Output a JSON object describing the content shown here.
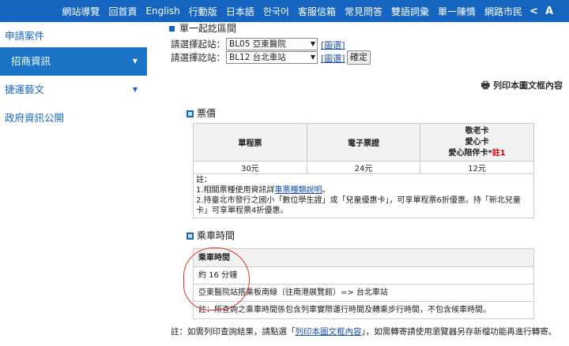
{
  "topnav": {
    "links": [
      "網站導覽",
      "回首頁",
      "English",
      "行動版",
      "日本語",
      "한국어",
      "客服信箱",
      "常見問答",
      "雙語詞彙",
      "單一陳情",
      "網路市民"
    ],
    "share_icon": "share-icon",
    "font_icon": "font-size-icon"
  },
  "sidebar": {
    "items": [
      {
        "label": "申請案件"
      },
      {
        "label": "招商資訊"
      },
      {
        "label": "捷運藝文"
      },
      {
        "label": "政府資訊公開"
      }
    ]
  },
  "main": {
    "section_title": "單一起訖區間",
    "start_label": "請選擇起站：",
    "start_value": "BL05 亞東醫院",
    "end_label": "請選擇訖站：",
    "end_value": "BL12 台北車站",
    "map_link": "[圖選]",
    "confirm_button": "確定",
    "print_label": "列印本圖文框內容",
    "fare_title": "票價",
    "fare_headers": [
      "單程票",
      "電子票證",
      "敬老卡",
      "愛心卡",
      "愛心陪伴卡*",
      "註1"
    ],
    "fare_values": [
      "30元",
      "24元",
      "12元"
    ],
    "note_prefix": "註：",
    "note_1_prefix": "1.相關票種使用資訊詳",
    "note_1_link": "車票種類說明",
    "note_1_suffix": "。",
    "note_2": "2.持臺北市發行之國小「數位學生證」或「兒童優惠卡」，可享單程票6折優惠。持「新北兒童卡」可享單程票4折優惠。",
    "time_title": "乘車時間",
    "time_header": "乘車時間",
    "time_value": "約 16 分鐘",
    "route": "亞東醫院站搭乘板南線（往南港展覽館）=> 台北車站",
    "time_note": "註：所查詢之乘車時間係包含列車實際運行時間及轉乘步行時間，不包含候車時間。",
    "footer_prefix": "註：如需列印查詢結果，請點選「",
    "footer_link": "列印本圖文框內容",
    "footer_suffix": "」，如需轉寄請使用瀏覽器另存新檔功能再進行轉寄。"
  }
}
